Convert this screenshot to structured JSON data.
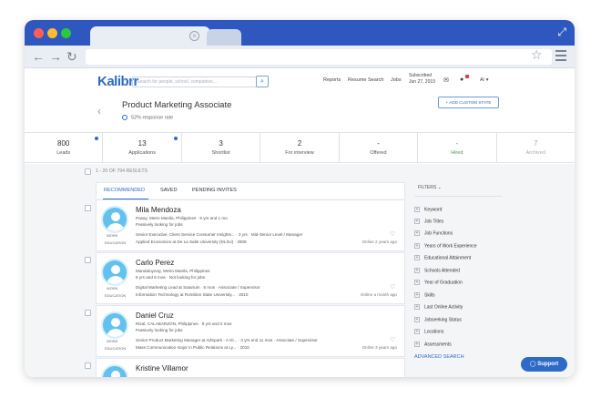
{
  "brand": {
    "logo": "Kalibrr",
    "accent": "#2e6bc6",
    "titlebar_color": "#2e57c0"
  },
  "header": {
    "search_placeholder": "Search for people, school, companies...",
    "links": [
      "Reports",
      "Resume Search",
      "Jobs"
    ],
    "subscribed_label": "Subscribed",
    "subscribed_date": "Jun 27, 2019",
    "user": "A/"
  },
  "job": {
    "title": "Product Marketing Associate",
    "response_rate": "52% response rate",
    "add_state_label": "+ ADD CUSTOM STATE"
  },
  "pipeline": [
    {
      "count": "800",
      "label": "Leads"
    },
    {
      "count": "13",
      "label": "Applications"
    },
    {
      "count": "3",
      "label": "Shortlist"
    },
    {
      "count": "2",
      "label": "For interview"
    },
    {
      "count": "-",
      "label": "Offered"
    },
    {
      "count": "-",
      "label": "Hired"
    },
    {
      "count": "7",
      "label": "Archived"
    }
  ],
  "results": {
    "summary": "1 - 20 OF 794 RESULTS"
  },
  "tabs": [
    "RECOMMENDED",
    "SAVED",
    "PENDING INVITES"
  ],
  "candidates": [
    {
      "name": "Mila Mendoza",
      "location": "Pasay, Metro Manila, Philippines · 9 yrs and 1 mo",
      "status": "Passively looking for jobs",
      "work_label": "WORK",
      "work": "Senior Executive, Client Service Consumer Insights... · 3 yrs · Mid-Senior Level / Manager",
      "education_label": "EDUCATION",
      "education": "Applied Economics at De La Salle University (DLSU) · 2009",
      "online": "Online 2 years ago"
    },
    {
      "name": "Carlo Perez",
      "location": "Mandaluyong, Metro Manila, Philippines",
      "status": "8 yrs and 6 mos · Not looking for jobs",
      "work_label": "WORK",
      "work": "Digital Marketing Lead at Satarium · 5 mos · Associate / Supervisor",
      "education_label": "EDUCATION",
      "education": "Information Technology at Romblon State University... · 2010",
      "online": "Online a month ago"
    },
    {
      "name": "Daniel Cruz",
      "location": "Rizal, CALABARZON, Philippines · 9 yrs and 2 mos",
      "status": "Passively looking for jobs",
      "work_label": "WORK",
      "work": "Senior Product Marketing Manager at AdSpark - A Gl... · 3 yrs and 11 mos · Associate / Supervisor",
      "education_label": "EDUCATION",
      "education": "Mass Communication major in Public Relations at Ly... · 2010",
      "online": "Online 3 years ago"
    },
    {
      "name": "Kristine Villamor"
    }
  ],
  "filters": {
    "heading": "FILTERS",
    "items": [
      "Keyword",
      "Job Titles",
      "Job Functions",
      "Years of Work Experience",
      "Educational Attainment",
      "Schools Attended",
      "Year of Graduation",
      "Skills",
      "Last Online Activity",
      "Jobseeking Status",
      "Locations",
      "Assessments"
    ],
    "advanced": "ADVANCED SEARCH"
  },
  "support_label": "Support"
}
